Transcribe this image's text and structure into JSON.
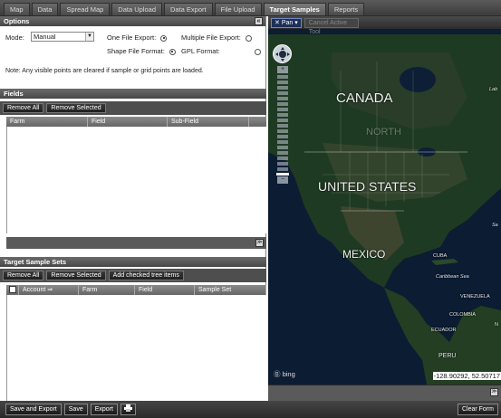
{
  "tabs": [
    "Map",
    "Data",
    "Spread Map",
    "Data Upload",
    "Data Export",
    "File Upload",
    "Target Samples",
    "Reports"
  ],
  "active_tab": "Target Samples",
  "options": {
    "title": "Options",
    "mode_label": "Mode:",
    "mode_value": "Manual",
    "one_file_export": "One File Export:",
    "multiple_file_export": "Multiple File Export:",
    "shape_file_format": "Shape File Format:",
    "gpl_format": "GPL Format:",
    "note": "Note: Any visible points are cleared if sample or grid points are loaded."
  },
  "fields": {
    "title": "Fields",
    "remove_all": "Remove All",
    "remove_selected": "Remove Selected",
    "columns": [
      "Farm",
      "Field",
      "Sub-Field"
    ]
  },
  "target_sets": {
    "title": "Target Sample Sets",
    "remove_all": "Remove All",
    "remove_selected": "Remove Selected",
    "add_checked": "Add checked tree items",
    "columns": [
      "Account",
      "Farm",
      "Field",
      "Sample Set"
    ]
  },
  "map": {
    "pan_label": "Pan",
    "disabled_button": "Cancel Active Tool",
    "labels": {
      "canada": "CANADA",
      "north": "NORTH",
      "united_states": "UNITED STATES",
      "mexico": "MEXICO",
      "caribbean": "Caribbean Sea",
      "cuba": "CUBA",
      "venezuela": "VENEZUELA",
      "colombia": "COLOMBIA",
      "ecuador": "ECUADOR",
      "peru": "PERU",
      "lab": "Lab",
      "sa": "Sa",
      "n": "N"
    },
    "provider": "bing",
    "coords": "-128.90292, 52.50717"
  },
  "bottom": {
    "save_export": "Save and Export",
    "save": "Save",
    "export": "Export",
    "print_icon": "print-icon",
    "clear_form": "Clear Form"
  }
}
